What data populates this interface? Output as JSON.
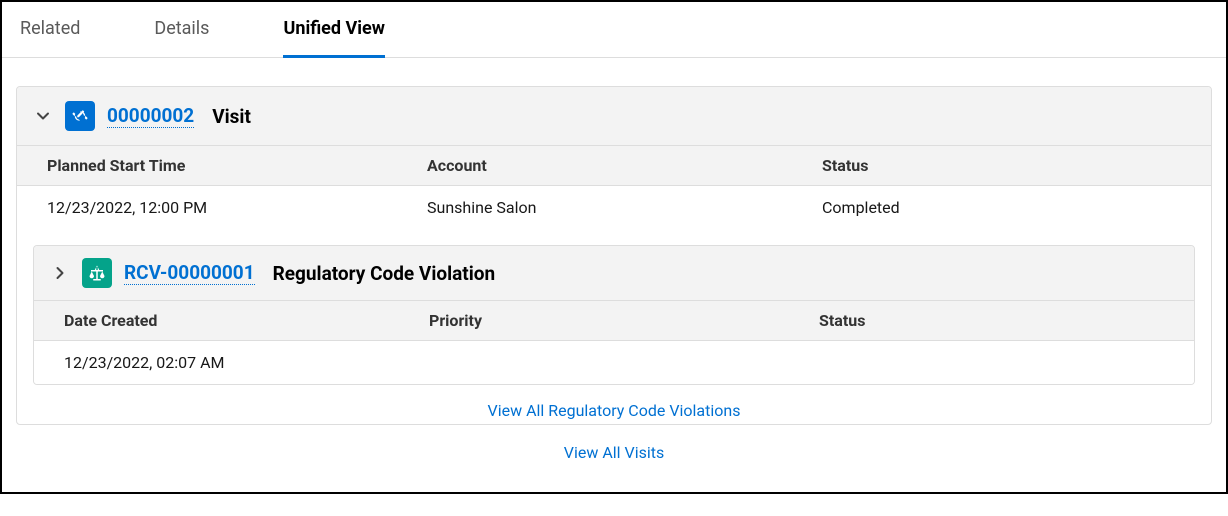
{
  "tabs": {
    "related": "Related",
    "details": "Details",
    "unified_view": "Unified View"
  },
  "visit": {
    "record_id": "00000002",
    "type_label": "Visit",
    "columns": {
      "planned_start": "Planned Start Time",
      "account": "Account",
      "status": "Status"
    },
    "row": {
      "planned_start": "12/23/2022, 12:00 PM",
      "account": "Sunshine Salon",
      "status": "Completed"
    }
  },
  "rcv": {
    "record_id": "RCV-00000001",
    "type_label": "Regulatory Code Violation",
    "columns": {
      "date_created": "Date Created",
      "priority": "Priority",
      "status": "Status"
    },
    "row": {
      "date_created": "12/23/2022, 02:07 AM",
      "priority": "",
      "status": ""
    },
    "view_all": "View All Regulatory Code Violations"
  },
  "view_all_visits": "View All Visits"
}
